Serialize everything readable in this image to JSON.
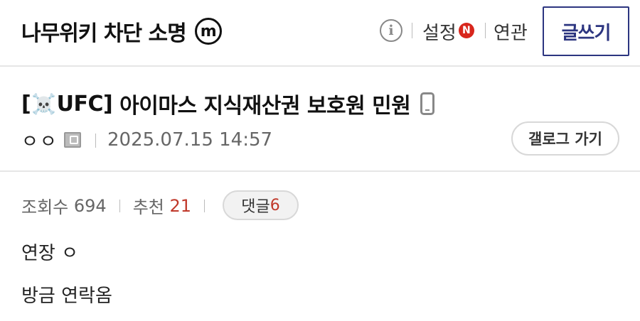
{
  "header": {
    "gallery_name": "나무위키 차단 소명",
    "minor_badge": "m",
    "info_icon": "info-icon",
    "settings_label": "설정",
    "new_badge": "N",
    "related_label": "연관",
    "write_label": "글쓰기"
  },
  "post": {
    "title_prefix_open": "[",
    "title_skull": "☠️",
    "title_tag": "UFC]",
    "title_text": "아이마스 지식재산권 보호원 민원",
    "author": "ㅇㅇ",
    "date": "2025.07.15 14:57",
    "gallery_button": "갤로그 가기",
    "views_label": "조회수",
    "views_value": "694",
    "recommend_label": "추천",
    "recommend_value": "21",
    "comments_label": "댓글",
    "comments_value": "6",
    "body_lines": [
      "연장 ㅇ",
      "방금 연락옴"
    ]
  },
  "colors": {
    "accent": "#2c3580",
    "red": "#c0392b",
    "new_badge": "#d8261c"
  }
}
